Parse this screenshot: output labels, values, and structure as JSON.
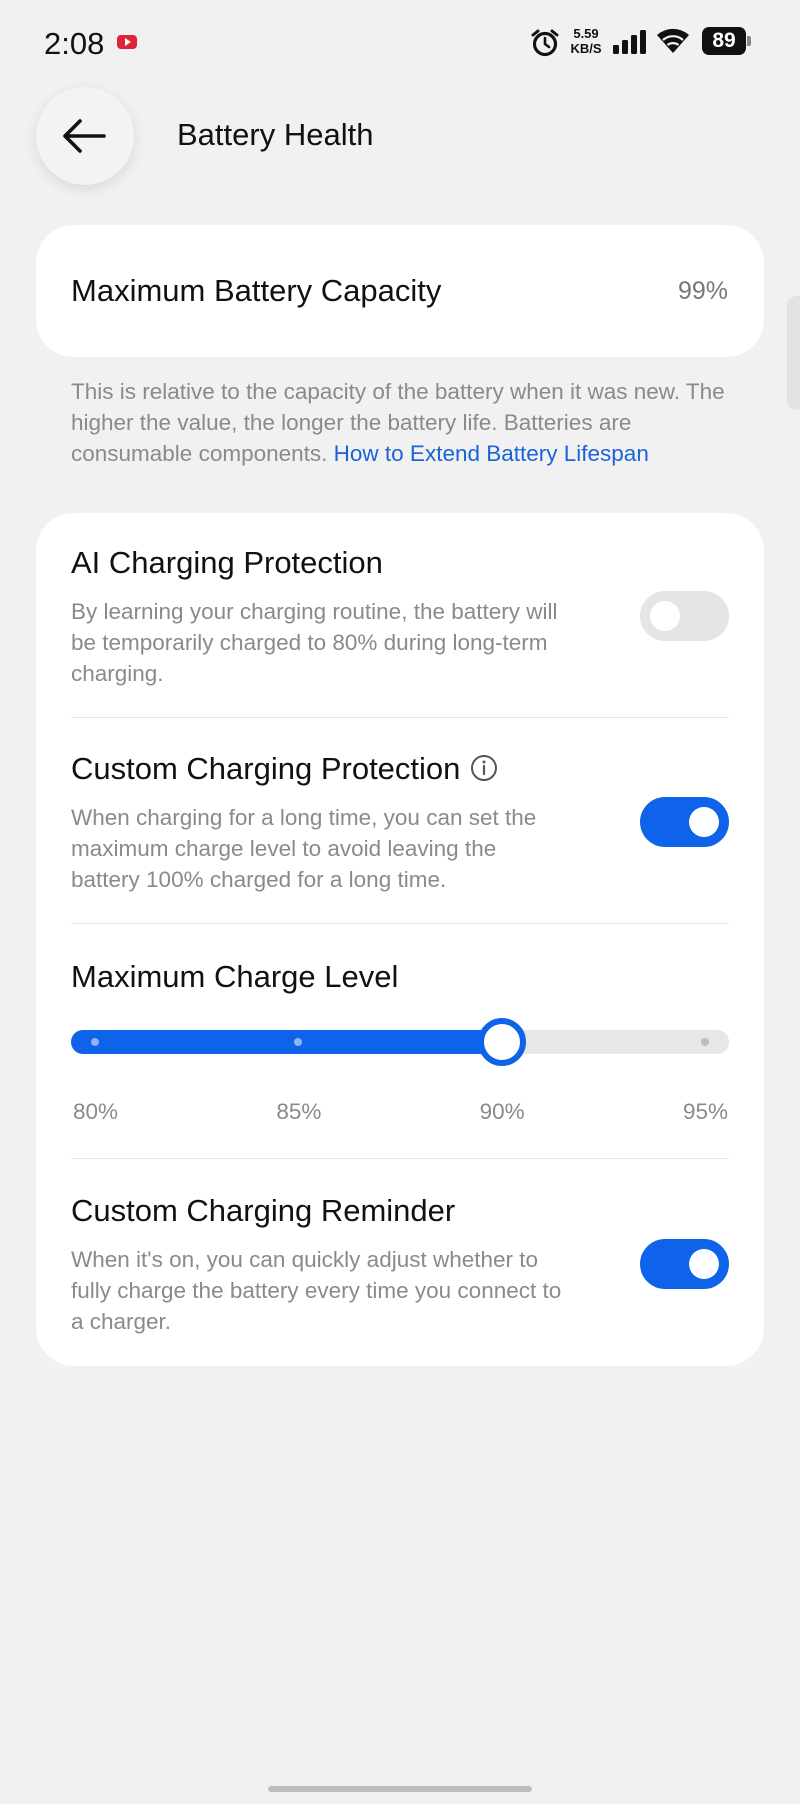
{
  "status_bar": {
    "time": "2:08",
    "speed_value": "5.59",
    "speed_unit": "KB/S",
    "battery_level": "89",
    "icons": [
      "youtube-notification-icon",
      "alarm-icon",
      "signal-icon",
      "wifi-icon",
      "battery-icon"
    ]
  },
  "header": {
    "title": "Battery Health",
    "back_icon": "back-arrow-icon"
  },
  "capacity": {
    "label": "Maximum Battery Capacity",
    "value": "99%",
    "note_text": "This is relative to the capacity of the battery when it was new. The higher the value, the longer the battery life. Batteries are consumable components. ",
    "note_link": "How to Extend Battery Lifespan"
  },
  "settings": {
    "ai_protection": {
      "title": "AI Charging Protection",
      "description": "By learning your charging routine, the battery will be temporarily charged to 80% during long-term charging.",
      "enabled": false
    },
    "custom_protection": {
      "title": "Custom Charging Protection",
      "description": "When charging for a long time, you can set the maximum charge level to avoid leaving the battery 100% charged for a long time.",
      "enabled": true,
      "info_icon": "info-icon"
    },
    "max_charge_level": {
      "title": "Maximum Charge Level",
      "options": [
        "80%",
        "85%",
        "90%",
        "95%"
      ],
      "selected_index": 2,
      "selected_value": "90%"
    },
    "charging_reminder": {
      "title": "Custom Charging Reminder",
      "description": "When it's on, you can quickly adjust whether to fully charge the battery every time you connect to a charger.",
      "enabled": true
    }
  },
  "colors": {
    "accent": "#0f63ea",
    "background": "#f1f1f1",
    "card": "#ffffff",
    "secondary_text": "#8a8a8a",
    "link": "#1a63d8"
  }
}
